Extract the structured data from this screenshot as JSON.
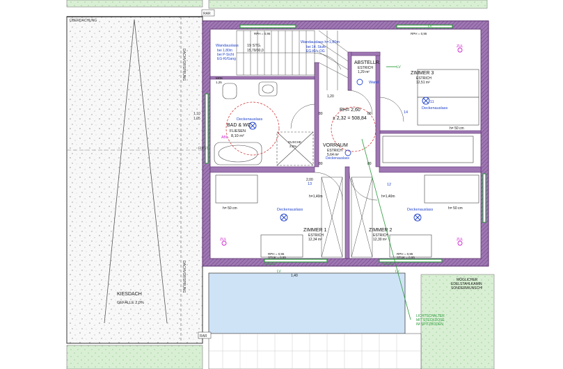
{
  "colors": {
    "wall": "#7a4f8f",
    "wall_inner": "#b48ac4",
    "blue": "#2244cc",
    "green": "#2a9a3a",
    "red": "#cc2222",
    "gravel": "#f7f7f7",
    "grass": "#d6eed2",
    "water": "#cfe3f7",
    "magenta": "#cc22cc"
  },
  "top": {
    "ueberdachung": "ÜBERDACHUNG",
    "rar_top": "RAR",
    "rar_bottom": "RAR"
  },
  "left": {
    "dachvorsprung_1": "DACHVORSPRUNG",
    "dachvorsprung_2": "DACHVORSPRUNG",
    "kiesdach": "KIESDACH",
    "gefaelle": "GEFÄLLE 2,0%",
    "first": "FIRST",
    "dim_110": "1,10",
    "dim_105": "1,05"
  },
  "stair": {
    "label": "19 STG.",
    "size": "15,79/30,0"
  },
  "wall_outlets": {
    "w1_title": "Wandauslass",
    "w1_l1": "bei 1,80m",
    "w1_l2": "bei P-Sicht",
    "w1_l3": "EG-Kl/Gang",
    "w2_title": "Wandauslass h=1,80m",
    "w2_l1": "bei 14. Stufe",
    "w2_l2": "EG-Kl/u.OG"
  },
  "rooms": {
    "bad_title": "BAD & WC",
    "bad_floor": "FLIESEN",
    "bad_area": "8,10 m²",
    "abstell_title": "ABSTELLR.",
    "abstell_floor": "ESTRICH",
    "abstell_area": "1,29 m²",
    "z3_title": "ZIMMER 3",
    "z3_floor": "ESTRICH",
    "z3_area": "12,51 m²",
    "vorraum_title": "VORRAUM",
    "vorraum_floor": "ESTRICH",
    "vorraum_area": "5,64 m²",
    "z1_title": "ZIMMER 1",
    "z1_floor": "ESTRICH",
    "z1_area": "12,34 m²",
    "z2_title": "ZIMMER 2",
    "z2_floor": "ESTRICH",
    "z2_area": "12,30 m²"
  },
  "annotations": {
    "rh": "RH= 2,60",
    "rh2": "± 2,32 = 508,84",
    "decken": "Deckenauslass",
    "wand": "Wand",
    "zul": "ZUL",
    "abl": "ABL",
    "h50": "h= 50 cm",
    "h140": "h=1,40m",
    "lv": "LV",
    "mok": "MOK",
    "mok_val": "1,25",
    "rph": "RPH = 0,95",
    "stuk": "STUK = 0,95",
    "dim_80": "80",
    "dim_200": "2,00",
    "dim_1_20": "1,20",
    "dim_1_40": "1,40",
    "num_11": "11",
    "num_12": "12",
    "num_13": "13",
    "num_14": "14",
    "dusche": "DUSCHE",
    "gefaelle_small": "2,0%"
  },
  "bottom_right": {
    "note1": "MÖGLICHER",
    "note2": "EDELSTAHLKAMIN",
    "note3": "SONDERWUNSCH!",
    "light1": "LICHTSCHALTER",
    "light2": "MIT STECKDOSE",
    "light3": "IM SPITZBODEN"
  }
}
